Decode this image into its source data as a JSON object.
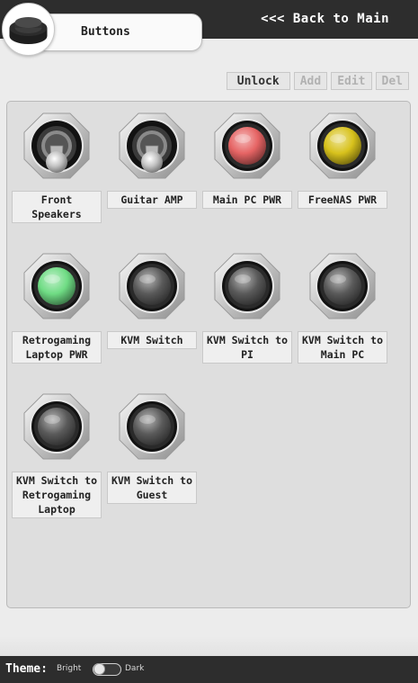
{
  "header": {
    "title": "Buttons",
    "back_label": "<<< Back to Main",
    "logo_icon": "push-button-icon"
  },
  "toolbar": {
    "unlock_label": "Unlock",
    "add_label": "Add",
    "edit_label": "Edit",
    "del_label": "Del"
  },
  "buttons": [
    {
      "label": "Front Speakers",
      "kind": "toggle"
    },
    {
      "label": "Guitar AMP",
      "kind": "toggle"
    },
    {
      "label": "Main PC PWR",
      "kind": "push",
      "color": "#e66464"
    },
    {
      "label": "FreeNAS PWR",
      "kind": "push",
      "color": "#d8c21c"
    },
    {
      "label": "Retrogaming Laptop PWR",
      "kind": "push",
      "color": "#6fdc84"
    },
    {
      "label": "KVM Switch",
      "kind": "push",
      "color": "#5a5a5a"
    },
    {
      "label": "KVM Switch to PI",
      "kind": "push",
      "color": "#5a5a5a"
    },
    {
      "label": "KVM Switch to Main PC",
      "kind": "push",
      "color": "#5a5a5a"
    },
    {
      "label": "KVM Switch to Retrogaming Laptop",
      "kind": "push",
      "color": "#5a5a5a"
    },
    {
      "label": "KVM Switch to Guest",
      "kind": "push",
      "color": "#5a5a5a"
    }
  ],
  "footer": {
    "theme_label": "Theme:",
    "bright_label": "Bright",
    "dark_label": "Dark",
    "theme_toggle_icon": "toggle-switch-icon"
  }
}
